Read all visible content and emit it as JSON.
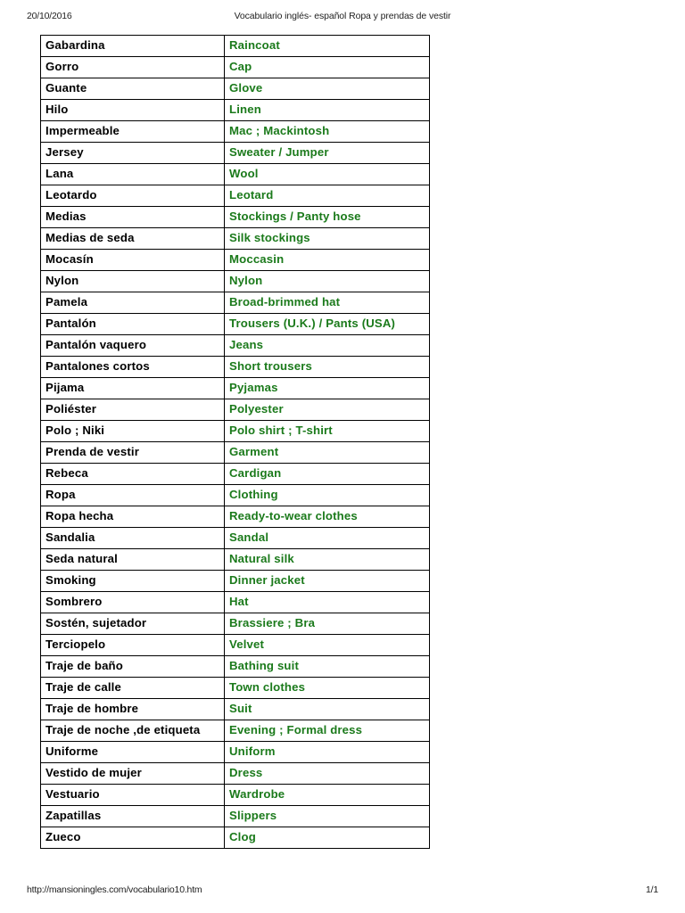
{
  "header": {
    "date": "20/10/2016",
    "title": "Vocabulario inglés- español Ropa y prendas de vestir"
  },
  "footer": {
    "url": "http://mansioningles.com/vocabulario10.htm",
    "page_number": "1/1"
  },
  "colors": {
    "english_text": "#1b7a1b",
    "spanish_text": "#000000",
    "table_border": "#000000",
    "page_background": "#ffffff"
  },
  "table": {
    "rows": [
      {
        "es": "Gabardina",
        "en": "Raincoat"
      },
      {
        "es": "Gorro",
        "en": "Cap"
      },
      {
        "es": "Guante",
        "en": "Glove"
      },
      {
        "es": "Hilo",
        "en": "Linen"
      },
      {
        "es": "Impermeable",
        "en": "Mac ; Mackintosh"
      },
      {
        "es": "Jersey",
        "en": "Sweater / Jumper"
      },
      {
        "es": "Lana",
        "en": "Wool"
      },
      {
        "es": "Leotardo",
        "en": "Leotard"
      },
      {
        "es": "Medias",
        "en": "Stockings / Panty hose"
      },
      {
        "es": "Medias de seda",
        "en": "Silk stockings"
      },
      {
        "es": "Mocasín",
        "en": "Moccasin"
      },
      {
        "es": "Nylon",
        "en": "Nylon"
      },
      {
        "es": "Pamela",
        "en": "Broad-brimmed hat"
      },
      {
        "es": "Pantalón",
        "en": "Trousers (U.K.) / Pants (USA)"
      },
      {
        "es": "Pantalón vaquero",
        "en": "Jeans"
      },
      {
        "es": "Pantalones cortos",
        "en": "Short trousers"
      },
      {
        "es": "Pijama",
        "en": "Pyjamas"
      },
      {
        "es": "Poliéster",
        "en": "Polyester"
      },
      {
        "es": "Polo ; Niki",
        "en": "Polo shirt ; T-shirt"
      },
      {
        "es": "Prenda de vestir",
        "en": "Garment"
      },
      {
        "es": "Rebeca",
        "en": "Cardigan"
      },
      {
        "es": "Ropa",
        "en": "Clothing"
      },
      {
        "es": "Ropa hecha",
        "en": "Ready-to-wear clothes"
      },
      {
        "es": "Sandalia",
        "en": "Sandal"
      },
      {
        "es": "Seda natural",
        "en": "Natural silk"
      },
      {
        "es": "Smoking",
        "en": "Dinner jacket"
      },
      {
        "es": "Sombrero",
        "en": "Hat"
      },
      {
        "es": "Sostén, sujetador",
        "en": "Brassiere ; Bra"
      },
      {
        "es": "Terciopelo",
        "en": "Velvet"
      },
      {
        "es": "Traje de baño",
        "en": "Bathing suit"
      },
      {
        "es": "Traje de calle",
        "en": "Town clothes"
      },
      {
        "es": "Traje de hombre",
        "en": "Suit"
      },
      {
        "es": "Traje de noche ,de etiqueta",
        "en": "Evening ; Formal dress"
      },
      {
        "es": "Uniforme",
        "en": "Uniform"
      },
      {
        "es": "Vestido de mujer",
        "en": "Dress"
      },
      {
        "es": "Vestuario",
        "en": "Wardrobe"
      },
      {
        "es": "Zapatillas",
        "en": "Slippers"
      },
      {
        "es": "Zueco",
        "en": "Clog"
      }
    ]
  }
}
